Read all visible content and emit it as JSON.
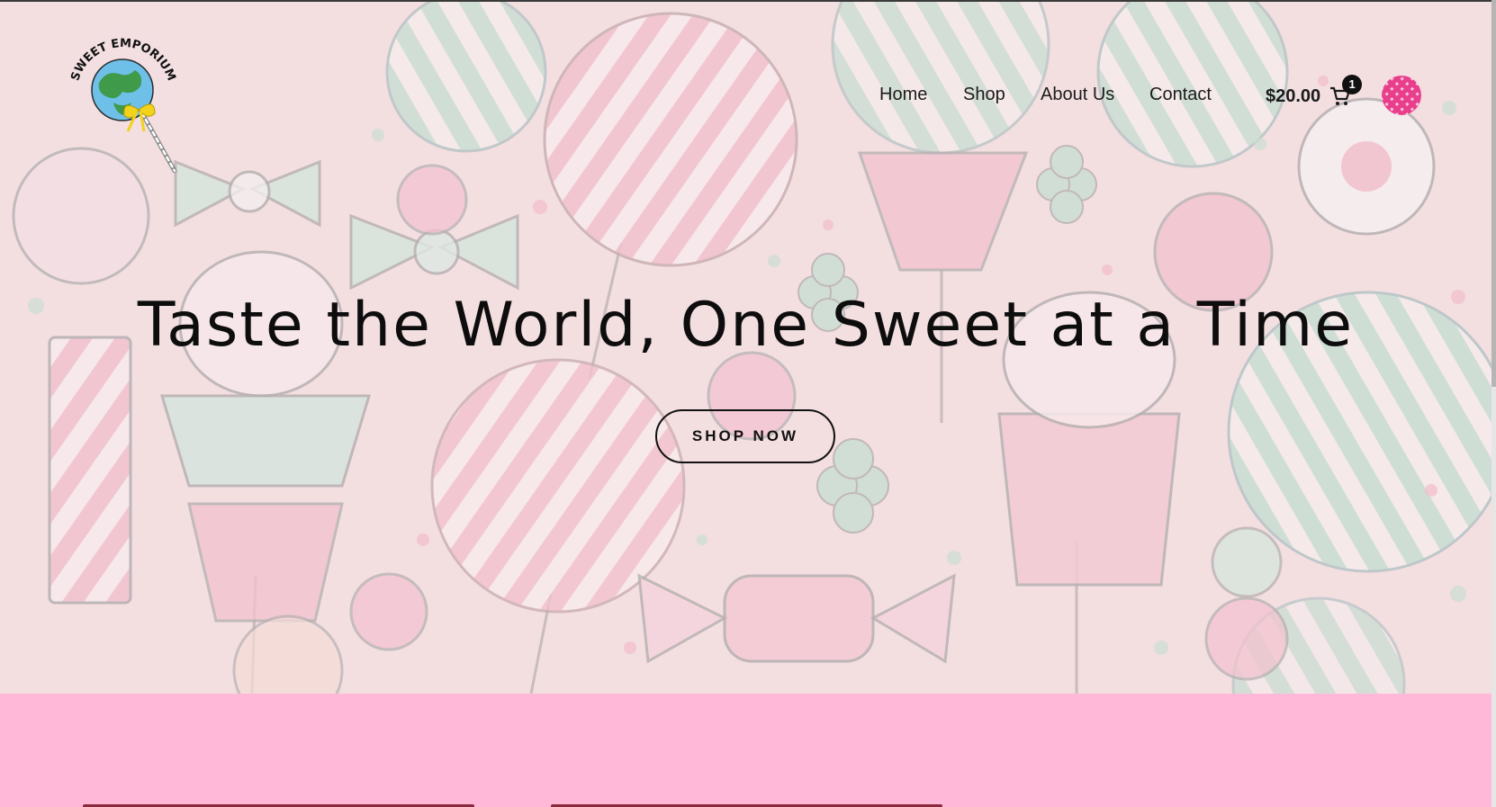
{
  "brand": {
    "logo_text": "SWEET EMPORIUM"
  },
  "nav": {
    "items": [
      {
        "label": "Home"
      },
      {
        "label": "Shop"
      },
      {
        "label": "About Us"
      },
      {
        "label": "Contact"
      }
    ]
  },
  "cart": {
    "total": "$20.00",
    "count": "1",
    "icon": "cart-icon"
  },
  "account": {
    "icon": "avatar-icon"
  },
  "hero": {
    "title": "Taste the World, One Sweet at a Time",
    "cta_label": "SHOP NOW"
  },
  "colors": {
    "hero_background": "#f1d7da",
    "band_pink": "#ffb8d8",
    "text_dark": "#0d0d0d",
    "candy_pink": "#ef9fb4",
    "candy_mint": "#9fd2bd"
  }
}
